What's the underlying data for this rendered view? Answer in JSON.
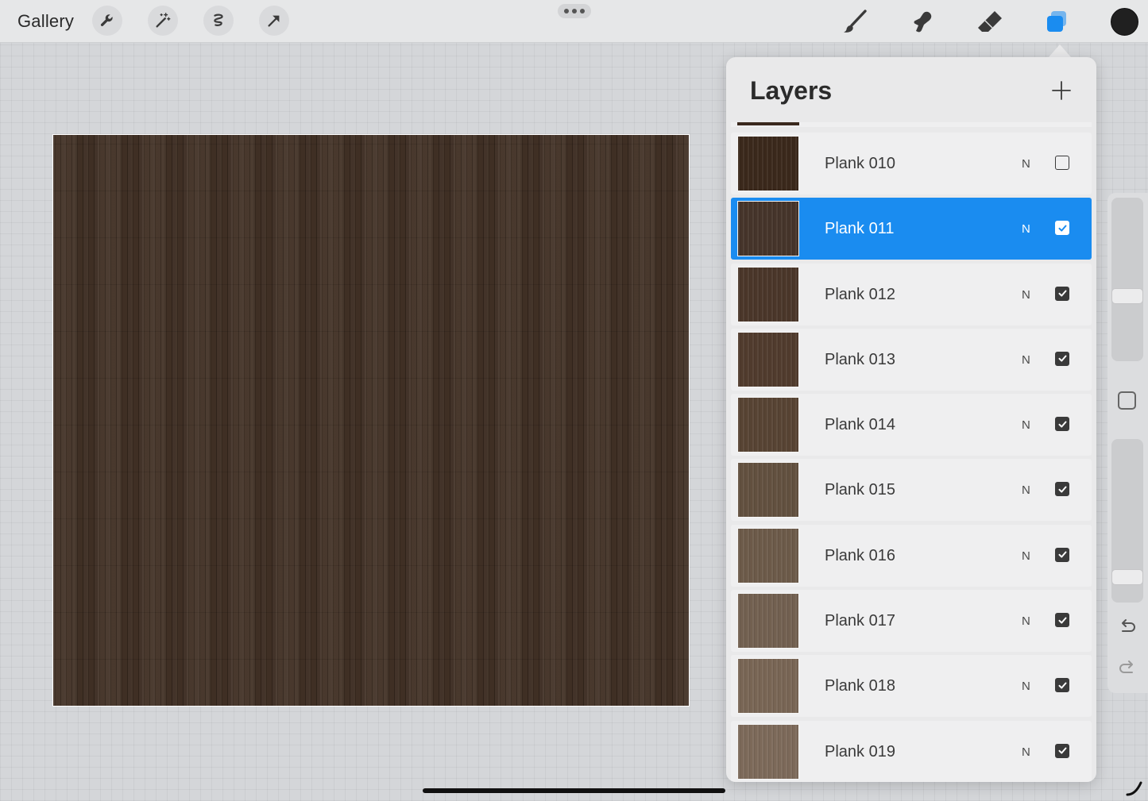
{
  "toolbar": {
    "gallery_label": "Gallery",
    "left_tools": [
      "wrench-icon",
      "magic-wand-icon",
      "selection-icon",
      "transform-arrow-icon"
    ],
    "more_icon": "ellipsis-icon",
    "right_tools": [
      "brush-icon",
      "smudge-icon",
      "eraser-icon",
      "layers-icon"
    ],
    "active_tool": "layers-icon",
    "current_color": "#202020",
    "accent_color": "#1a8cf0"
  },
  "canvas": {
    "texture": "dark wood plank floor",
    "base_color": "#3f2e22"
  },
  "layers_panel": {
    "title": "Layers",
    "add_icon": "plus-icon",
    "layers": [
      {
        "name": "Plank 010",
        "blend": "N",
        "visible": false,
        "selected": false,
        "thumb": "#3a281b"
      },
      {
        "name": "Plank 011",
        "blend": "N",
        "visible": true,
        "selected": true,
        "thumb": "#45342a"
      },
      {
        "name": "Plank 012",
        "blend": "N",
        "visible": true,
        "selected": false,
        "thumb": "#4a3629"
      },
      {
        "name": "Plank 013",
        "blend": "N",
        "visible": true,
        "selected": false,
        "thumb": "#503b2d"
      },
      {
        "name": "Plank 014",
        "blend": "N",
        "visible": true,
        "selected": false,
        "thumb": "#574333"
      },
      {
        "name": "Plank 015",
        "blend": "N",
        "visible": true,
        "selected": false,
        "thumb": "#62503f"
      },
      {
        "name": "Plank 016",
        "blend": "N",
        "visible": true,
        "selected": false,
        "thumb": "#6c5a49"
      },
      {
        "name": "Plank 017",
        "blend": "N",
        "visible": true,
        "selected": false,
        "thumb": "#726050"
      },
      {
        "name": "Plank 018",
        "blend": "N",
        "visible": true,
        "selected": false,
        "thumb": "#786554"
      },
      {
        "name": "Plank 019",
        "blend": "N",
        "visible": true,
        "selected": false,
        "thumb": "#7c6959"
      }
    ]
  },
  "sidebar": {
    "brush_size_slider": "size-slider",
    "opacity_slider": "opacity-slider",
    "modify_icon": "modify-square-icon",
    "undo_icon": "undo-icon",
    "redo_icon": "redo-icon"
  }
}
